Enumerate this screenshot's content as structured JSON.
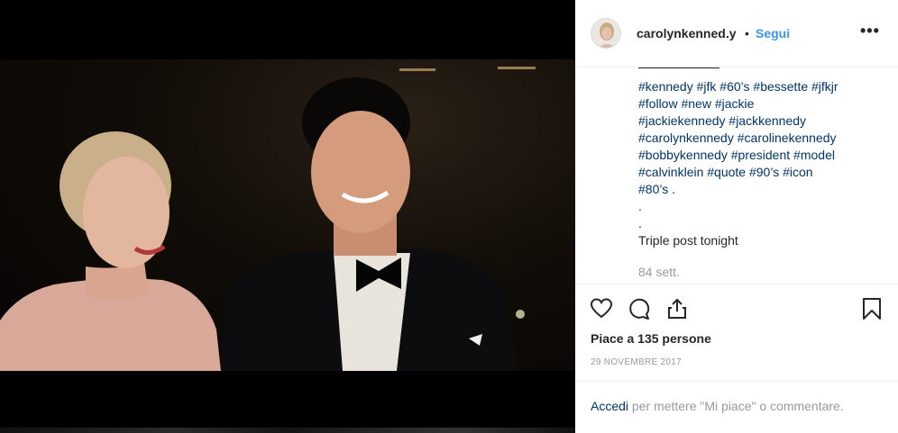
{
  "post": {
    "username": "carolynkenned.y",
    "dot": "•",
    "follow_label": "Segui",
    "more_label": "•••",
    "caption_tags": [
      "#kennedy",
      "#jfk",
      "#60’s",
      "#bessette",
      "#jfkjr",
      "#follow",
      "#new",
      "#jackie",
      "#jackiekennedy",
      "#jackkennedy",
      "#carolynkennedy",
      "#carolinekennedy",
      "#bobbykennedy",
      "#president",
      "#model",
      "#calvinklein",
      "#quote",
      "#90’s",
      "#icon",
      "#80’s"
    ],
    "caption_tail": ".",
    "caption_dot1": ".",
    "caption_dot2": ".",
    "caption_text": "Triple post tonight",
    "time_ago": "84 sett.",
    "likes_text": "Piace a 135 persone",
    "date": "29 NOVEMBRE 2017",
    "login_link": "Accedi",
    "login_text": " per mettere \"Mi piace\" o commentare."
  },
  "icons": [
    "heart-icon",
    "comment-icon",
    "share-icon",
    "bookmark-icon"
  ]
}
